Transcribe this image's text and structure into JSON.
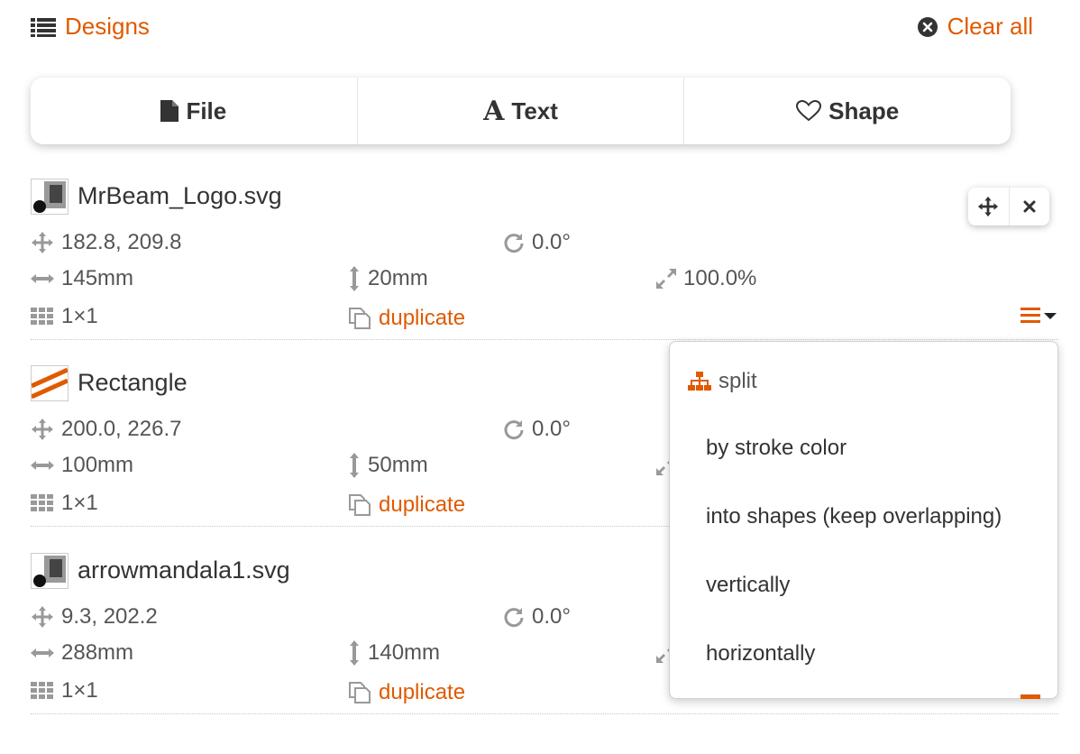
{
  "header": {
    "designs_label": "Designs",
    "clear_all_label": "Clear all"
  },
  "tabs": [
    {
      "label": "File",
      "icon": "file-icon"
    },
    {
      "label": "Text",
      "icon": "text-icon"
    },
    {
      "label": "Shape",
      "icon": "heart-icon"
    }
  ],
  "designs": [
    {
      "name": "MrBeam_Logo.svg",
      "position": "182.8, 209.8",
      "rotation": "0.0°",
      "width": "145mm",
      "height": "20mm",
      "scale": "100.0%",
      "grid": "1×1",
      "duplicate_label": "duplicate",
      "thumb": "image-thumb"
    },
    {
      "name": "Rectangle",
      "position": "200.0, 226.7",
      "rotation": "0.0°",
      "width": "100mm",
      "height": "50mm",
      "grid": "1×1",
      "duplicate_label": "duplicate",
      "thumb": "rectangle-thumb"
    },
    {
      "name": "arrowmandala1.svg",
      "position": "9.3, 202.2",
      "rotation": "0.0°",
      "width": "288mm",
      "height": "140mm",
      "grid": "1×1",
      "duplicate_label": "duplicate",
      "thumb": "image-thumb"
    }
  ],
  "dropdown": {
    "header": "split",
    "items": [
      "by stroke color",
      "into shapes (keep overlapping)",
      "vertically",
      "horizontally"
    ]
  },
  "colors": {
    "accent": "#e05a00",
    "text": "#3c3c3c",
    "muted": "#888888"
  }
}
